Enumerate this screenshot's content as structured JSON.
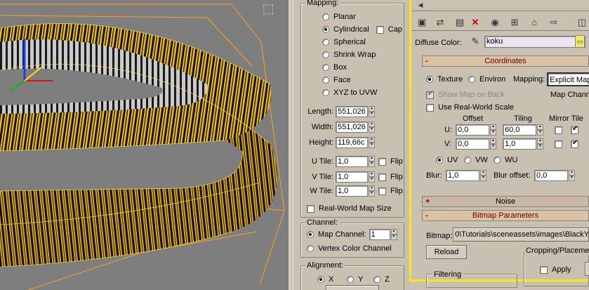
{
  "viewport": {
    "corner_icon": "viewport-cube-icon"
  },
  "mapping": {
    "group_title": "Mapping:",
    "types": [
      {
        "label": "Planar",
        "selected": false
      },
      {
        "label": "Cylindrical",
        "selected": true
      },
      {
        "label": "Spherical",
        "selected": false
      },
      {
        "label": "Shrink Wrap",
        "selected": false
      },
      {
        "label": "Box",
        "selected": false
      },
      {
        "label": "Face",
        "selected": false
      },
      {
        "label": "XYZ to UVW",
        "selected": false
      }
    ],
    "cap_label": "Cap",
    "cap_checked": false,
    "length": {
      "label": "Length:",
      "value": "551,026"
    },
    "width": {
      "label": "Width:",
      "value": "551,026"
    },
    "height": {
      "label": "Height:",
      "value": "119,66c"
    },
    "u_tile": {
      "label": "U Tile:",
      "value": "1,0",
      "flip_label": "Flip"
    },
    "v_tile": {
      "label": "V Tile:",
      "value": "1,0",
      "flip_label": "Flip"
    },
    "w_tile": {
      "label": "W Tile:",
      "value": "1,0",
      "flip_label": "Flip"
    },
    "real_world_label": "Real-World Map Size"
  },
  "channel": {
    "group_title": "Channel:",
    "map_channel_label": "Map Channel:",
    "map_channel_value": "1",
    "vertex_color_label": "Vertex Color Channel"
  },
  "alignment": {
    "group_title": "Alignment:",
    "axes": [
      {
        "label": "X",
        "selected": true
      },
      {
        "label": "Y",
        "selected": false
      },
      {
        "label": "Z",
        "selected": false
      }
    ]
  },
  "material_editor": {
    "toolbar_icons": [
      "arrow-icon",
      "get-material-icon",
      "put-material-icon",
      "delete-icon",
      "material-id-icon",
      "show-map-icon",
      "go-parent-icon"
    ],
    "diffuse_label": "Diffuse Color:",
    "diffuse_value": "koku",
    "coordinates": {
      "header": "Coordinates",
      "sign": "-",
      "texture_label": "Texture",
      "environ_label": "Environ",
      "mapping_label": "Mapping:",
      "mapping_value": "Explicit Map",
      "show_map_label": "Show Map on Back",
      "map_channel_label": "Map Chann",
      "real_world_label": "Use Real-World Scale",
      "offset_label": "Offset",
      "tiling_label": "Tiling",
      "mirror_tile_label": "Mirror Tile",
      "u_label": "U:",
      "v_label": "V:",
      "u_offset": "0,0",
      "v_offset": "0,0",
      "u_tiling": "60,0",
      "v_tiling": "1,0",
      "uv_options": [
        {
          "label": "UV",
          "selected": true
        },
        {
          "label": "VW",
          "selected": false
        },
        {
          "label": "WU",
          "selected": false
        }
      ],
      "blur_label": "Blur:",
      "blur_value": "1,0",
      "blur_offset_label": "Blur offset:",
      "blur_offset_value": "0,0"
    },
    "noise": {
      "header": "Noise",
      "sign": "+"
    },
    "bitmap": {
      "header": "Bitmap Parameters",
      "sign": "-",
      "bitmap_label": "Bitmap:",
      "bitmap_path": "0\\Tutorials\\sceneassets\\images\\BlackYe",
      "reload_label": "Reload",
      "cropping_label": "Cropping/Placeme",
      "apply_label": "Apply",
      "filtering_label": "Filtering"
    }
  }
}
